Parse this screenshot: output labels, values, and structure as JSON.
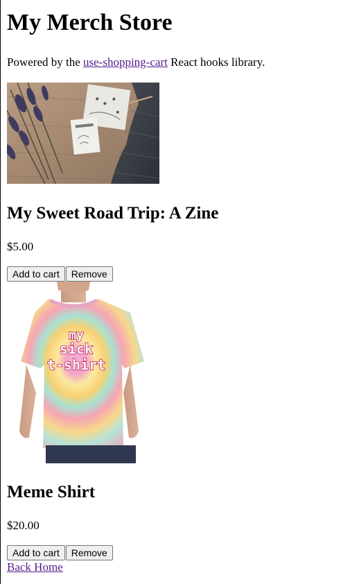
{
  "store": {
    "title": "My Merch Store",
    "intro_prefix": "Powered by the ",
    "intro_link": "use-shopping-cart",
    "intro_suffix": " React hooks library."
  },
  "products": [
    {
      "name": "My Sweet Road Trip: A Zine",
      "price": "$5.00",
      "image_alt": "zine-photo",
      "add_label": "Add to cart",
      "remove_label": "Remove"
    },
    {
      "name": "Meme Shirt",
      "price": "$20.00",
      "image_alt": "tie-dye-shirt-photo",
      "shirt_text_line1": "my",
      "shirt_text_line2": "sick",
      "shirt_text_line3": "t-shirt",
      "add_label": "Add to cart",
      "remove_label": "Remove"
    }
  ],
  "footer": {
    "back_link": "Back Home"
  },
  "colors": {
    "link": "#551a8b",
    "button_bg": "#efefef",
    "button_border": "#767676"
  }
}
